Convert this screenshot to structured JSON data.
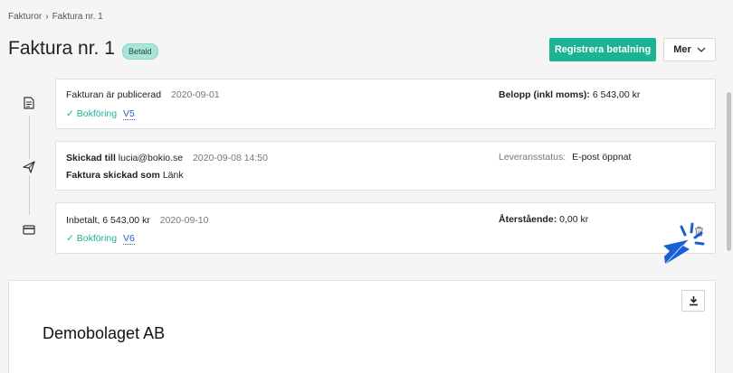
{
  "breadcrumb": {
    "root": "Fakturor",
    "separator": "›",
    "current": "Faktura nr. 1"
  },
  "header": {
    "title": "Faktura nr. 1",
    "status_badge": "Betald"
  },
  "actions": {
    "primary": "Registrera betalning",
    "more": "Mer"
  },
  "events": [
    {
      "icon": "document-icon",
      "text": "Fakturan är publicerad",
      "date": "2020-09-01",
      "check": "✓",
      "booking_label": "Bokföring",
      "booking_ref": "V5",
      "right_label": "Belopp (inkl moms):",
      "right_value": "6 543,00 kr"
    },
    {
      "icon": "send-icon",
      "sent_label": "Skickad till",
      "email": "lucia@bokio.se",
      "date": "2020-09-08 14:50",
      "sent_as_label": "Faktura skickad som",
      "sent_as_value": "Länk",
      "right_label": "Leveransstatus:",
      "right_value": "E-post öppnat"
    },
    {
      "icon": "card-icon",
      "text": "Inbetalt, 6 543,00 kr",
      "date": "2020-09-10",
      "check": "✓",
      "booking_label": "Bokföring",
      "booking_ref": "V6",
      "right_label": "Återstående:",
      "right_value": "0,00 kr"
    }
  ],
  "document": {
    "company": "Demobolaget AB"
  },
  "colors": {
    "accent": "#1bb394",
    "link": "#2a64c5",
    "badge_bg": "#a9e4d7",
    "cursor": "#1a5fd6"
  }
}
